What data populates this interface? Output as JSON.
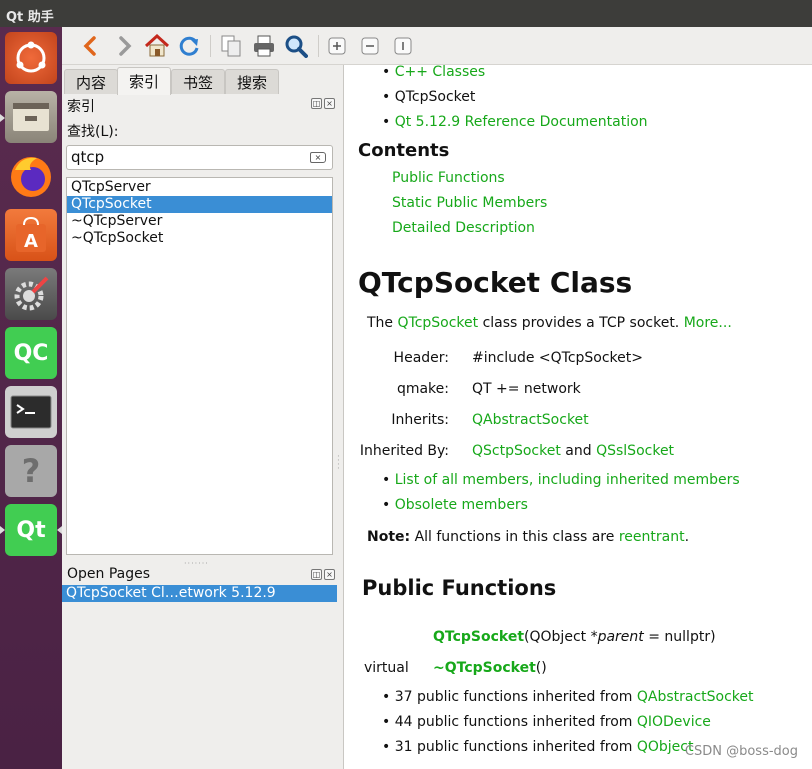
{
  "window": {
    "title": "Qt 助手"
  },
  "launcher": {
    "items": [
      {
        "name": "ubuntu-dash"
      },
      {
        "name": "files"
      },
      {
        "name": "firefox"
      },
      {
        "name": "software-center"
      },
      {
        "name": "system-settings"
      },
      {
        "name": "qt-creator",
        "label": "QC"
      },
      {
        "name": "terminal"
      },
      {
        "name": "help",
        "label": "?"
      },
      {
        "name": "qt-assistant",
        "label": "Qt"
      }
    ]
  },
  "toolbar": {
    "buttons": [
      "back",
      "forward",
      "home",
      "sync",
      "copy",
      "print",
      "find",
      "zoom-in",
      "zoom-out",
      "reset-zoom"
    ]
  },
  "sidebar": {
    "tabs": [
      "内容",
      "索引",
      "书签",
      "搜索"
    ],
    "active_tab": "索引",
    "index_title": "索引",
    "find_label": "查找(L):",
    "search_value": "qtcp",
    "results": [
      "QTcpServer",
      "QTcpSocket",
      "~QTcpServer",
      "~QTcpSocket"
    ],
    "selected_index": 1,
    "open_pages_title": "Open Pages",
    "open_pages": [
      "QTcpSocket Cl…etwork 5.12.9"
    ]
  },
  "doc": {
    "breadcrumbs": [
      "C++ Classes",
      "QTcpSocket",
      "Qt 5.12.9 Reference Documentation"
    ],
    "contents_heading": "Contents",
    "contents_links": [
      "Public Functions",
      "Static Public Members",
      "Detailed Description"
    ],
    "class_title": "QTcpSocket Class",
    "intro": {
      "pre": "The ",
      "link": "QTcpSocket",
      "mid": " class provides a TCP socket. ",
      "more": "More..."
    },
    "info": {
      "header_label": "Header:",
      "header_value": "#include <QTcpSocket>",
      "qmake_label": "qmake:",
      "qmake_value": "QT += network",
      "inherits_label": "Inherits:",
      "inherits_value": "QAbstractSocket",
      "inherited_by_label": "Inherited By:",
      "inherited_by_a": "QSctpSocket",
      "inherited_by_and": " and ",
      "inherited_by_b": "QSslSocket"
    },
    "member_links": [
      "List of all members, including inherited members",
      "Obsolete members"
    ],
    "note": {
      "bold": "Note:",
      "text": " All functions in this class are ",
      "link": "reentrant",
      "end": "."
    },
    "public_functions_heading": "Public Functions",
    "functions": [
      {
        "qualifier": "",
        "name": "QTcpSocket",
        "args_pre": "(QObject *",
        "param": "parent",
        "args_post": " = nullptr)"
      },
      {
        "qualifier": "virtual",
        "name": "~QTcpSocket",
        "args_pre": "()",
        "param": "",
        "args_post": ""
      }
    ],
    "inherited": [
      {
        "text": "37 public functions inherited from ",
        "link": "QAbstractSocket"
      },
      {
        "text": "44 public functions inherited from ",
        "link": "QIODevice"
      },
      {
        "text": "31 public functions inherited from ",
        "link": "QObject"
      }
    ]
  },
  "watermark": "CSDN @boss-dog"
}
